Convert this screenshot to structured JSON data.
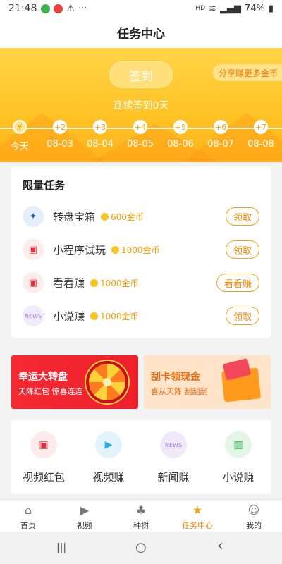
{
  "status_bar": {
    "time": "21:48",
    "extra": "···",
    "hd": "HD",
    "battery": "74%"
  },
  "title": "任务中心",
  "banner": {
    "checkin_label": "签到",
    "share_label": "分享赚更多金币",
    "streak_text": "连续签到0天",
    "days": [
      {
        "badge": "¥",
        "label": "今天"
      },
      {
        "badge": "+2",
        "label": "08-03"
      },
      {
        "badge": "+3",
        "label": "08-04"
      },
      {
        "badge": "+4",
        "label": "08-05"
      },
      {
        "badge": "+5",
        "label": "08-06"
      },
      {
        "badge": "+6",
        "label": "08-07"
      },
      {
        "badge": "+7",
        "label": "08-08"
      }
    ]
  },
  "tasks": {
    "title": "限量任务",
    "items": [
      {
        "name": "转盘宝箱",
        "reward": "600金币",
        "button": "领取",
        "icon": "compass-icon",
        "icon_color": "#1e5bbf",
        "icon_bg": "#e6eefb"
      },
      {
        "name": "小程序试玩",
        "reward": "1000金币",
        "button": "领取",
        "icon": "red-envelope-icon",
        "icon_color": "#e8303a",
        "icon_bg": "#fdecec"
      },
      {
        "name": "看看赚",
        "reward": "1000金币",
        "button": "看看赚",
        "icon": "red-envelope-icon",
        "icon_color": "#e8303a",
        "icon_bg": "#fdecec"
      },
      {
        "name": "小说赚",
        "reward": "1000金币",
        "button": "领取",
        "icon": "news-icon",
        "icon_color": "#9b7bd8",
        "icon_bg": "#f1ecfb"
      }
    ]
  },
  "promos": {
    "wheel": {
      "title": "幸运大转盘",
      "sub": "天降红包  惊喜连连"
    },
    "card": {
      "title": "刮卡领现金",
      "sub": "喜从天降  刮刮刮"
    }
  },
  "shortcuts": [
    {
      "label": "视频红包",
      "icon": "red-envelope-icon",
      "bg": "#fdebeb",
      "fg": "#e8303a"
    },
    {
      "label": "视频赚",
      "icon": "play-icon",
      "bg": "#e3f3fb",
      "fg": "#2aa6e0"
    },
    {
      "label": "新闻赚",
      "icon": "news-icon",
      "bg": "#efe9fa",
      "fg": "#8f6ed3"
    },
    {
      "label": "小说赚",
      "icon": "book-icon",
      "bg": "#e3f6e6",
      "fg": "#2fb24a"
    }
  ],
  "tabbar": [
    {
      "label": "首页",
      "icon": "home-icon",
      "glyph": "⌂",
      "active": false
    },
    {
      "label": "视频",
      "icon": "video-icon",
      "glyph": "▶",
      "active": false
    },
    {
      "label": "种树",
      "icon": "tree-icon",
      "glyph": "♣",
      "active": false
    },
    {
      "label": "任务中心",
      "icon": "task-center-icon",
      "glyph": "★",
      "active": true
    },
    {
      "label": "我的",
      "icon": "profile-icon",
      "glyph": "☺",
      "active": false
    }
  ],
  "nav_bar": {
    "recents": "|||",
    "home": "○",
    "back": "‹"
  },
  "colors": {
    "accent": "#f0a00a",
    "banner": "#ffc425",
    "wheel_banner": "#f42a33",
    "card_banner": "#ffe4c9"
  }
}
